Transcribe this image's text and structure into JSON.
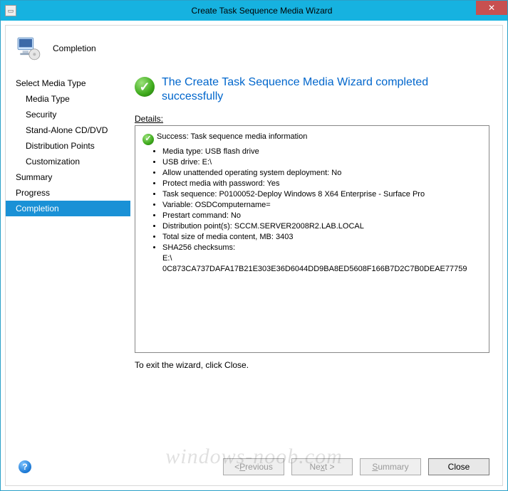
{
  "window": {
    "title": "Create Task Sequence Media Wizard"
  },
  "header": {
    "label": "Completion"
  },
  "sidebar": {
    "items": [
      {
        "label": "Select Media Type",
        "sub": false,
        "selected": false
      },
      {
        "label": "Media Type",
        "sub": true,
        "selected": false
      },
      {
        "label": "Security",
        "sub": true,
        "selected": false
      },
      {
        "label": "Stand-Alone CD/DVD",
        "sub": true,
        "selected": false
      },
      {
        "label": "Distribution Points",
        "sub": true,
        "selected": false
      },
      {
        "label": "Customization",
        "sub": true,
        "selected": false
      },
      {
        "label": "Summary",
        "sub": false,
        "selected": false
      },
      {
        "label": "Progress",
        "sub": false,
        "selected": false
      },
      {
        "label": "Completion",
        "sub": false,
        "selected": true
      }
    ]
  },
  "status": {
    "headline": "The Create Task Sequence Media Wizard completed successfully"
  },
  "details": {
    "label_prefix": "D",
    "label_rest": "etails:",
    "success_line": "Success: Task sequence media information",
    "bullets": [
      "Media type: USB flash drive",
      "USB drive: E:\\",
      "Allow unattended operating system deployment: No",
      "Protect media with password: Yes",
      "Task sequence: P0100052-Deploy Windows 8 X64 Enterprise - Surface Pro",
      "Variable: OSDComputername=",
      "Prestart command: No",
      "Distribution point(s): SCCM.SERVER2008R2.LAB.LOCAL",
      "Total size of media content, MB:  3403",
      "SHA256 checksums:"
    ],
    "checksum_drive": "E:\\",
    "checksum_value": "0C873CA737DAFA17B21E303E36D6044DD9BA8ED5608F166B7D2C7B0DEAE77759"
  },
  "exit_note": "To exit the wizard, click Close.",
  "buttons": {
    "previous_ul": "P",
    "previous_rest": "revious",
    "next_pre": "Ne",
    "next_ul": "x",
    "next_rest": "t >",
    "summary_ul": "S",
    "summary_rest": "ummary",
    "close": "Close"
  },
  "watermark": "windows-noob.com"
}
